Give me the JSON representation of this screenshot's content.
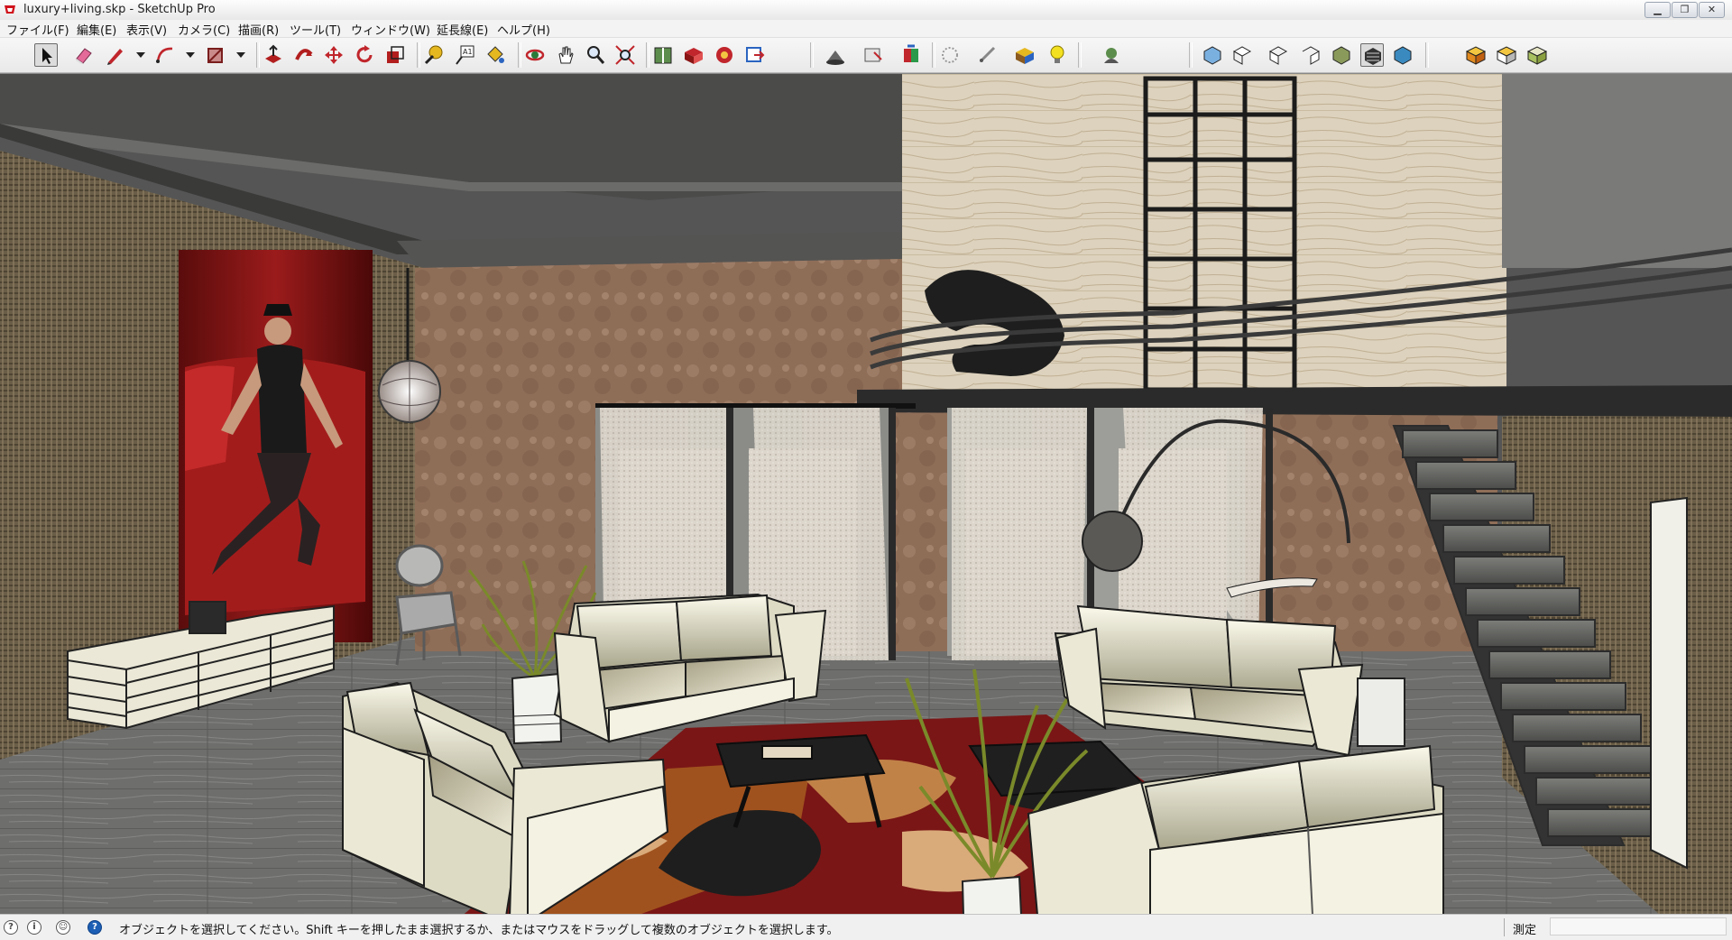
{
  "window": {
    "title": "luxury+living.skp - SketchUp Pro",
    "controls": [
      "minimize",
      "restore",
      "close"
    ]
  },
  "menu": {
    "items": [
      "ファイル(F)",
      "編集(E)",
      "表示(V)",
      "カメラ(C)",
      "描画(R)",
      "ツール(T)",
      "ウィンドウ(W)",
      "延長線(E)",
      "ヘルプ(H)"
    ]
  },
  "toolbar": {
    "tools": [
      "select",
      "eraser",
      "line",
      "arc",
      "rectangle",
      "push-pull",
      "follow-me",
      "move",
      "rotate",
      "scale",
      "tape-measure",
      "text",
      "paint-bucket",
      "orbit",
      "pan",
      "zoom",
      "zoom-extents",
      "warehouse",
      "components",
      "extension-warehouse",
      "layout",
      "shadows",
      "section",
      "styles",
      "fog",
      "dimension",
      "model-info",
      "light",
      "profile",
      "iso-view",
      "top-view",
      "front-view",
      "right-view",
      "back-view",
      "left-view",
      "xray",
      "wireframe",
      "hidden-line",
      "shaded",
      "shaded-with-textures",
      "monochrome"
    ],
    "active_tool": "select"
  },
  "viewport": {
    "scene": "3D interior model of a luxury living room with loft"
  },
  "status": {
    "message": "オブジェクトを選択してください。Shift キーを押したまま選択するか、またはマウスをドラッグして複数のオブジェクトを選択します。",
    "measure_label": "測定",
    "measure_value": ""
  },
  "colors": {
    "selected_tool_border": "#6a6a6a",
    "help_icon": "#1c5fb4",
    "sofa": "#ebe9d5",
    "rug_red": "#7a1616",
    "floor": "#6e6e6c"
  }
}
